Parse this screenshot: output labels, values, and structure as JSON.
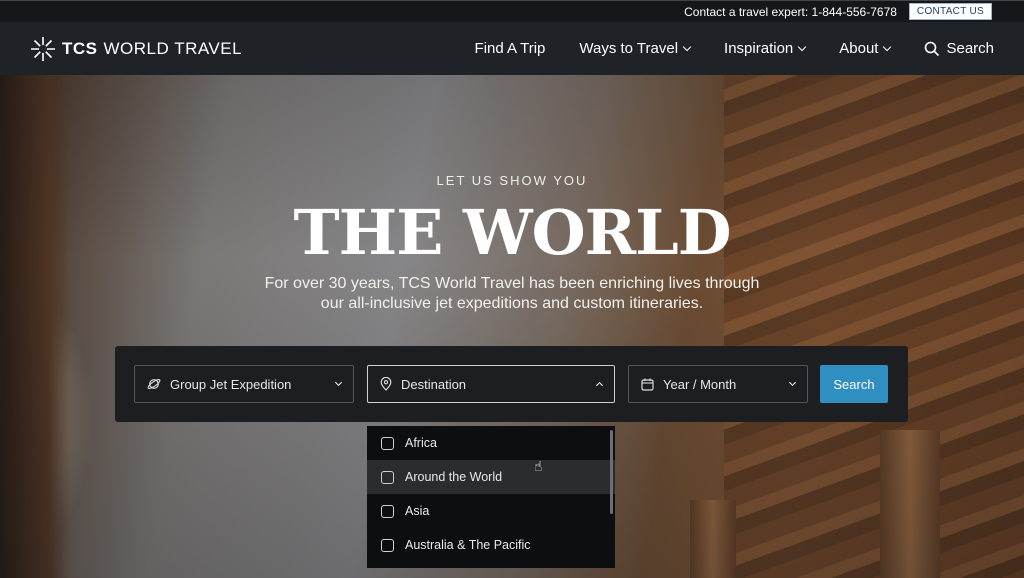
{
  "topbar": {
    "contact_text": "Contact a travel expert: 1-844-556-7678",
    "contact_button": "CONTACT US"
  },
  "logo": {
    "brand_strong": "TCS",
    "brand_rest": "WORLD TRAVEL"
  },
  "nav": {
    "items": [
      {
        "label": "Find A Trip",
        "has_dropdown": false
      },
      {
        "label": "Ways to Travel",
        "has_dropdown": true
      },
      {
        "label": "Inspiration",
        "has_dropdown": true
      },
      {
        "label": "About",
        "has_dropdown": true
      }
    ],
    "search_label": "Search"
  },
  "hero": {
    "eyebrow": "LET US SHOW YOU",
    "headline": "THE WORLD",
    "subtext": "For over  30 years, TCS World Travel has been enriching lives through our all-inclusive jet expeditions and custom itineraries."
  },
  "search_panel": {
    "trip_type": "Group Jet Expedition",
    "destination": "Destination",
    "date": "Year / Month",
    "search_button": "Search"
  },
  "destination_dropdown": {
    "options": [
      {
        "label": "Africa",
        "checked": false
      },
      {
        "label": "Around the World",
        "checked": false
      },
      {
        "label": "Asia",
        "checked": false
      },
      {
        "label": "Australia & The Pacific",
        "checked": false
      }
    ]
  },
  "colors": {
    "accent": "#2f8fc0",
    "nav_bg": "#1f2227",
    "panel_bg": "#1c1e22"
  }
}
